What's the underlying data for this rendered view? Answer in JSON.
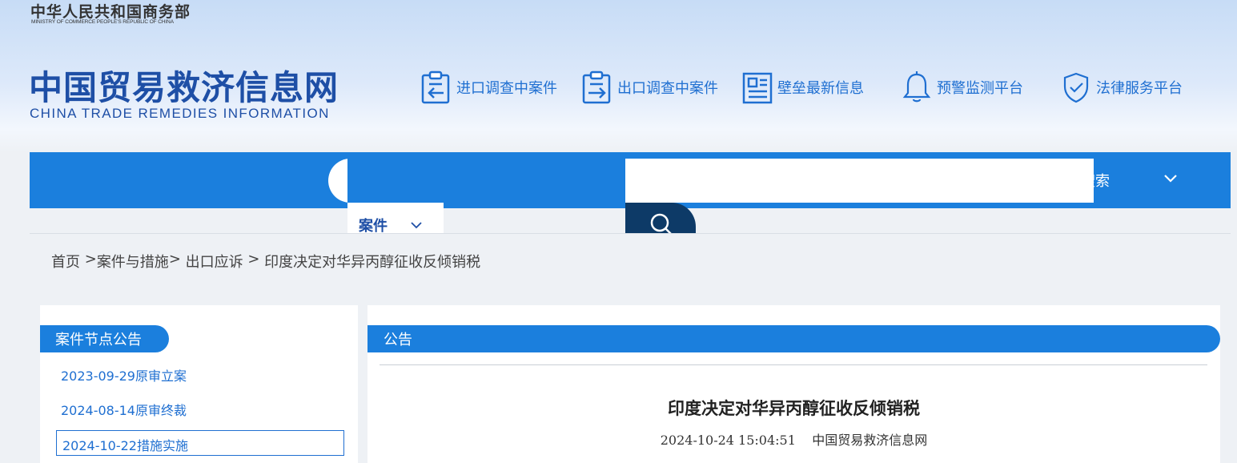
{
  "header": {
    "ministry_cn": "中华人民共和国商务部",
    "ministry_en": "MINISTRY OF COMMERCE PEOPLE'S REPUBLIC OF CHINA",
    "site_cn": "中国贸易救济信息网",
    "site_en": "CHINA TRADE REMEDIES INFORMATION",
    "quick_links": [
      {
        "label": "进口调查中案件",
        "icon": "import-clipboard-icon"
      },
      {
        "label": "出口调查中案件",
        "icon": "export-clipboard-icon"
      },
      {
        "label": "壁垒最新信息",
        "icon": "news-icon"
      },
      {
        "label": "预警监测平台",
        "icon": "bell-icon"
      },
      {
        "label": "法律服务平台",
        "icon": "shield-icon"
      }
    ]
  },
  "nav": {
    "search_placeholder": "",
    "search_label": "搜索",
    "dropdown_selected": "案件"
  },
  "breadcrumb": {
    "home": "首页",
    "sep1": " >",
    "section": "案件与措施",
    "sep2": "> ",
    "subsection": "出口应诉",
    "sep3": " > ",
    "current": "印度决定对华异丙醇征收反倾销税"
  },
  "sidebar": {
    "title": "案件节点公告",
    "items": [
      {
        "label": "2023-09-29原审立案"
      },
      {
        "label": "2024-08-14原审终裁"
      },
      {
        "label": "2024-10-22措施实施"
      }
    ]
  },
  "main": {
    "title": "公告",
    "article_title": "印度决定对华异丙醇征收反倾销税",
    "article_datetime": "2024-10-24 15:04:51",
    "article_source": "中国贸易救济信息网"
  },
  "colors": {
    "primary": "#1b7fdd",
    "brand_dark": "#1e4fa6",
    "search_button": "#0d3a67"
  }
}
